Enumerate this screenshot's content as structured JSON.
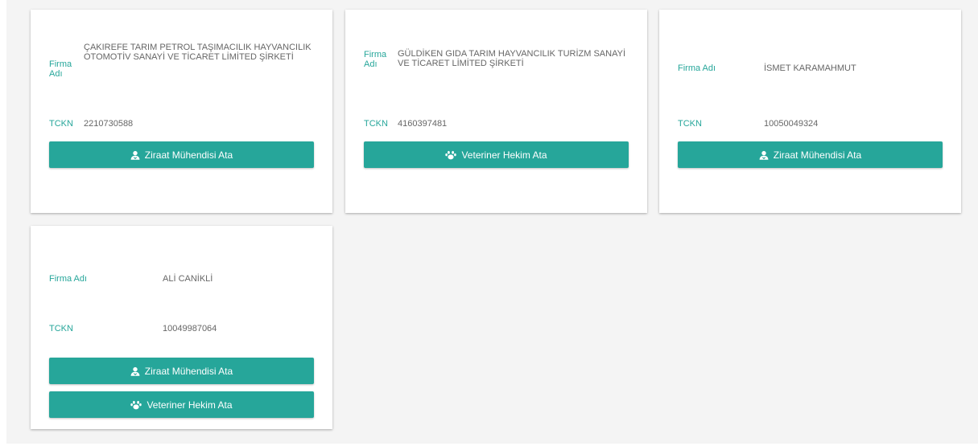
{
  "firms": [
    {
      "firm_label": "Firma Adı",
      "firm_name": "ÇAKIREFE TARIM PETROL TAŞIMACILIK HAYVANCILIK OTOMOTİV SANAYİ VE TİCARET LİMİTED ŞİRKETİ",
      "tckn_label": "TCKN",
      "tckn": "2210730588",
      "buttons": [
        {
          "label": "Ziraat Mühendisi Ata",
          "icon": "agriculture-engineer-icon"
        }
      ]
    },
    {
      "firm_label": "Firma Adı",
      "firm_name": "GÜLDİKEN GIDA TARIM HAYVANCILIK TURİZM SANAYİ VE TİCARET LİMİTED ŞİRKETİ",
      "tckn_label": "TCKN",
      "tckn": "4160397481",
      "buttons": [
        {
          "label": "Veteriner Hekim Ata",
          "icon": "paw-icon"
        }
      ]
    },
    {
      "firm_label": "Firma Adı",
      "firm_name": "İSMET KARAMAHMUT",
      "tckn_label": "TCKN",
      "tckn": "10050049324",
      "buttons": [
        {
          "label": "Ziraat Mühendisi Ata",
          "icon": "agriculture-engineer-icon"
        }
      ]
    },
    {
      "firm_label": "Firma Adı",
      "firm_name": "ALİ CANİKLİ",
      "tckn_label": "TCKN",
      "tckn": "10049987064",
      "buttons": [
        {
          "label": "Ziraat Mühendisi Ata",
          "icon": "agriculture-engineer-icon"
        },
        {
          "label": "Veteriner Hekim Ata",
          "icon": "paw-icon"
        }
      ]
    }
  ],
  "colors": {
    "accent": "#26a69a",
    "value_text": "#666666",
    "background": "#f4f4f4",
    "card": "#ffffff"
  }
}
